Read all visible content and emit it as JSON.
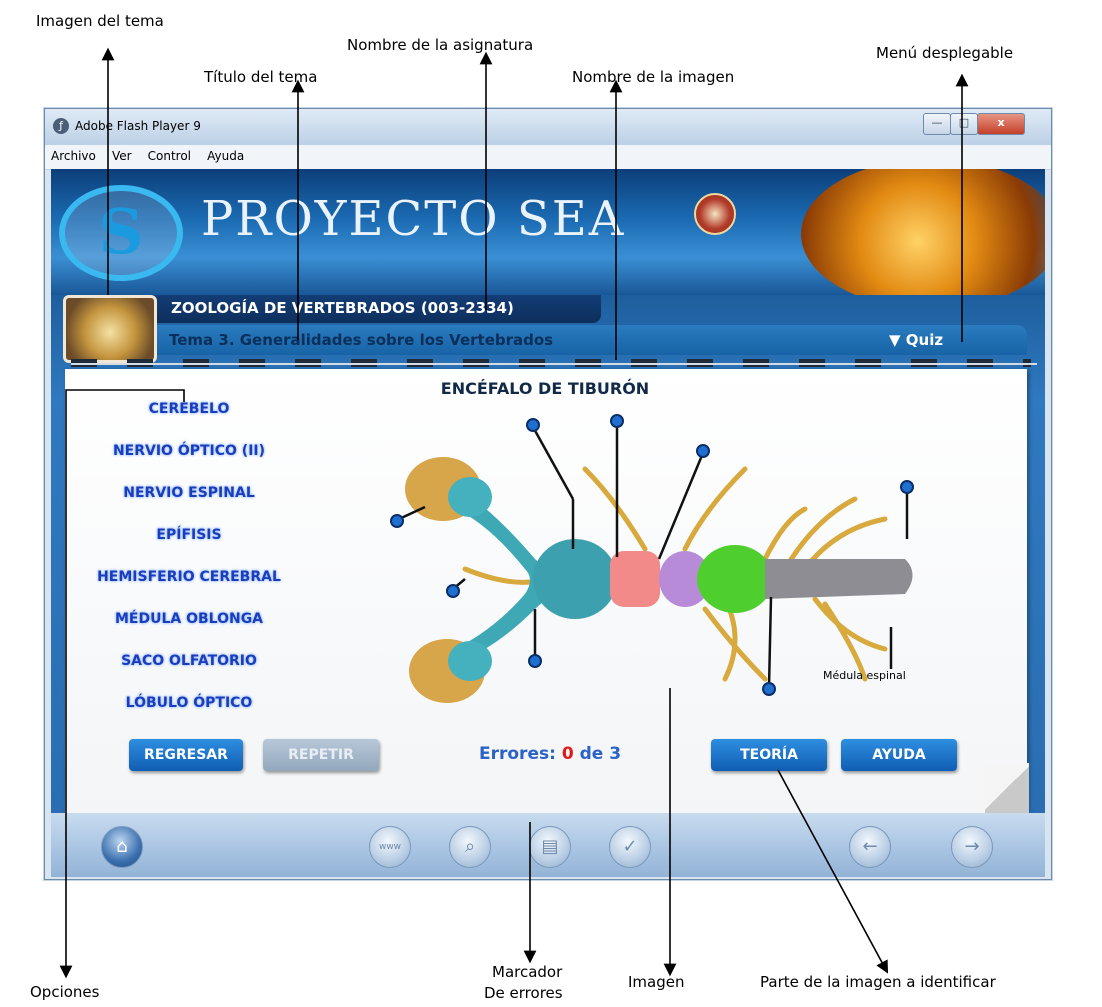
{
  "window": {
    "title": "Adobe Flash Player 9",
    "menu": [
      "Archivo",
      "Ver",
      "Control",
      "Ayuda"
    ],
    "controls": {
      "minimize": "—",
      "maximize": "□",
      "close": "x"
    }
  },
  "banner": {
    "title": "PROYECTO SEA"
  },
  "course": {
    "subject": "ZOOLOGÍA DE VERTEBRADOS (003-2334)",
    "topic": "Tema 3. Generalidades sobre los Vertebrados",
    "dropdown_label": "▼ Quiz"
  },
  "exercise": {
    "image_title": "ENCÉFALO DE TIBURÓN",
    "options": [
      "CEREBELO",
      "NERVIO ÓPTICO (II)",
      "NERVIO ESPINAL",
      "EPÍFISIS",
      "HEMISFERIO CEREBRAL",
      "MÉDULA OBLONGA",
      "SACO OLFATORIO",
      "LÓBULO ÓPTICO"
    ],
    "identified_label": "Médula espinal",
    "errors": {
      "label": "Errores: ",
      "count": "0",
      "suffix": " de 3"
    },
    "buttons": {
      "back": "REGRESAR",
      "repeat": "REPETIR",
      "theory": "TEORÍA",
      "help": "AYUDA"
    }
  },
  "toolbar": {
    "icons": [
      "home-icon",
      "web-icon",
      "search-icon",
      "book-icon",
      "check-icon",
      "back-arrow-icon",
      "forward-arrow-icon"
    ],
    "web_text": "www"
  },
  "callouts": {
    "topic_image": "Imagen del tema",
    "subject_name": "Nombre de la asignatura",
    "topic_title": "Título del tema",
    "image_name": "Nombre de la imagen",
    "dropdown_menu": "Menú desplegable",
    "options": "Opciones",
    "error_counter_line1": "Marcador",
    "error_counter_line2": "De errores",
    "image": "Imagen",
    "part_to_identify": "Parte de la imagen a identificar"
  }
}
